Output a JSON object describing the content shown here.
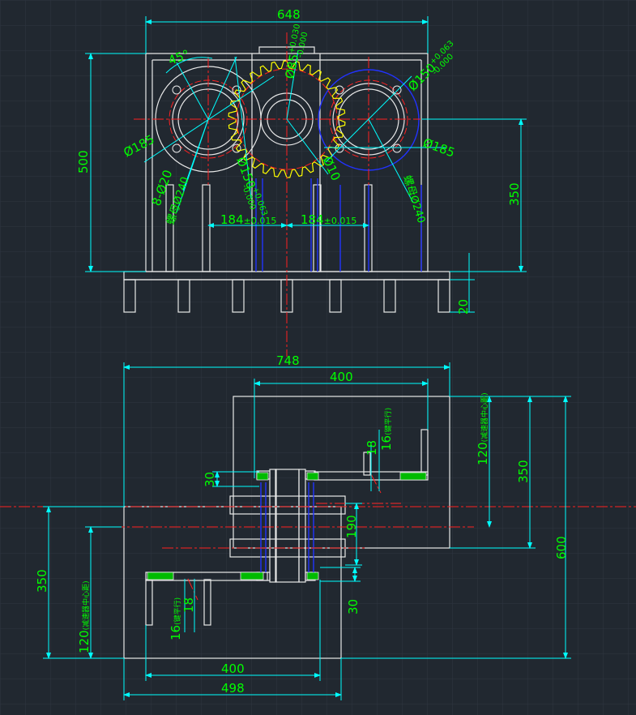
{
  "colors": {
    "background": "#212830",
    "grid": "#2e3641",
    "outline": "#e8e8e8",
    "dimension": "#00ffff",
    "dim_text": "#00ff00",
    "center_line": "#ff0000",
    "hidden_line": "#0000ff",
    "gear": "#ffff00",
    "hatch": "#00aa00"
  },
  "front_view": {
    "width_dim": "648",
    "height_dim": "500",
    "shaft_height_dim": "350",
    "foot_height_dim": "20",
    "center_dist_left": "184",
    "center_dist_right": "184",
    "tolerance": "±0.015",
    "angle": "45°",
    "bore_left": "Ø150",
    "bore_left_tol_top": "+0.063",
    "bore_left_tol_bot": "-0.000",
    "bore_right": "Ø150",
    "bore_right_tol_top": "+0.063",
    "bore_right_tol_bot": "-0.000",
    "center_bore": "Ø85",
    "center_bore_tol_top": "+0.030",
    "center_bore_tol_bot": "-0.000",
    "pcd_left": "Ø185",
    "pcd_right": "Ø185",
    "holes": "8-Ø20",
    "flange_left": "螺母Ø240",
    "flange_right": "螺母Ø240",
    "center_small": "Ø10"
  },
  "top_view": {
    "width_total": "748",
    "width_top": "400",
    "width_bottom_inner": "400",
    "width_bottom_total": "498",
    "depth_total": "600",
    "depth_right": "350",
    "depth_left": "350",
    "upper_offset": "120",
    "upper_offset_note": "(减速器中心距)",
    "lower_offset": "120",
    "lower_offset_note": "(减速器中心距)",
    "shaft_spacing": "190",
    "gap_upper": "30",
    "gap_lower": "30",
    "pin_upper_a": "18",
    "pin_upper_b": "16",
    "pin_upper_b_note": "(键平行)",
    "pin_lower_a": "18",
    "pin_lower_b": "16",
    "pin_lower_b_note": "(键平行)"
  }
}
